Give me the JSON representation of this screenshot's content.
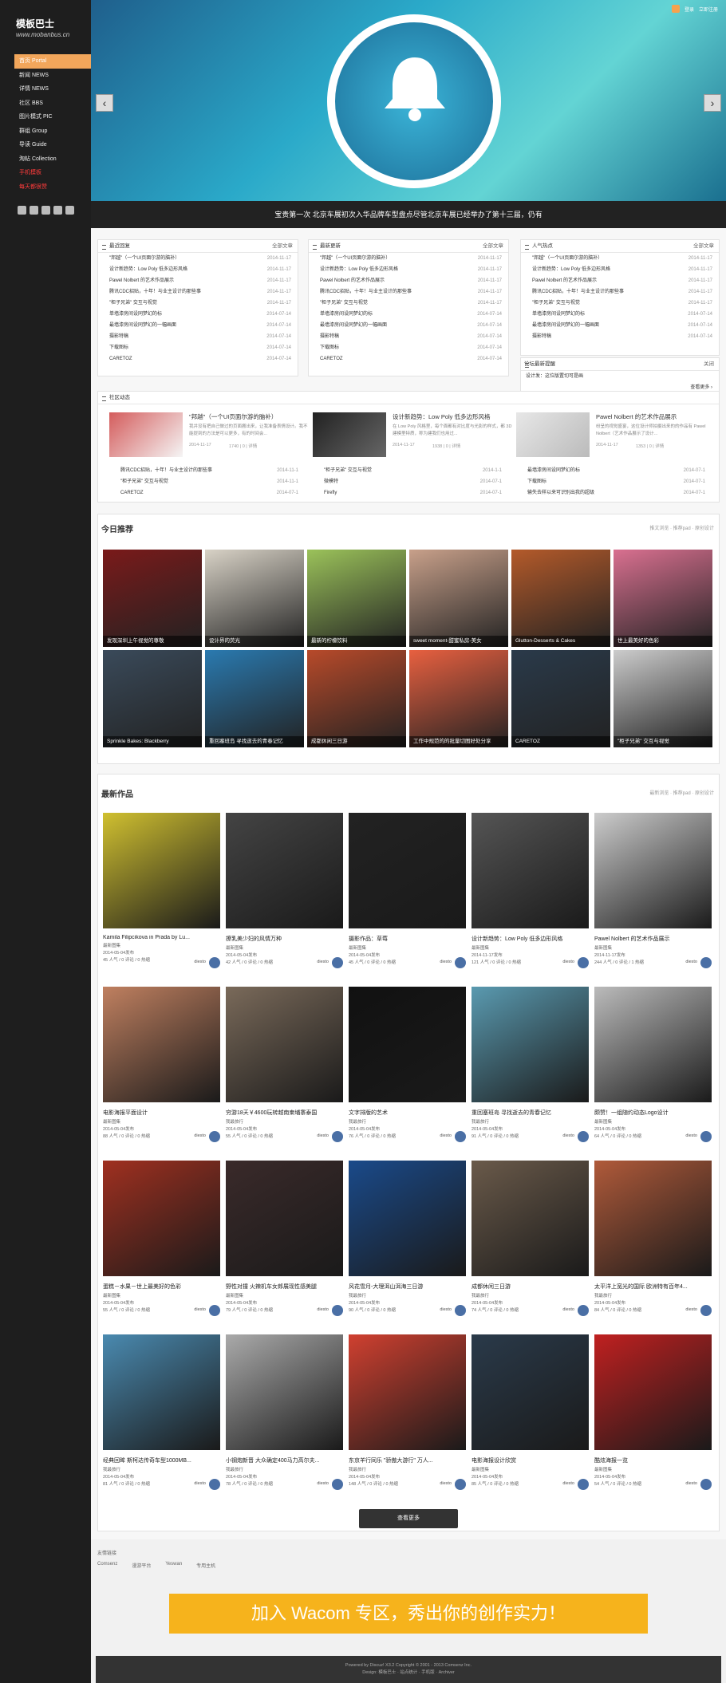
{
  "logo": {
    "title": "模板巴士",
    "sub": "www.mobanbus.cn"
  },
  "nav": [
    "首页 Portal",
    "新闻 NEWS",
    "详情 NEWS",
    "社区 BBS",
    "图片模式 PIC",
    "群组 Group",
    "导读 Guide",
    "淘帖 Collection",
    "手机模板",
    "每天都很赞"
  ],
  "topbar": {
    "login": "登录",
    "register": "立即注册"
  },
  "banner": {
    "caption": "宝贵第一次 北京车展初次入华品牌车型盘点尽管北京车展已经举办了第十三届，仍有"
  },
  "panels": [
    {
      "title": "最近回复",
      "more": "全部文章",
      "items": [
        [
          "\"邦越\"（一个UI页面尔游的脑补）",
          "2014-11-17"
        ],
        [
          "设计新趋势：Low Poly 低多边形风格",
          "2014-11-17"
        ],
        [
          "Pawel Nolbert 的艺术作品展示",
          "2014-11-17"
        ],
        [
          "腾讯CDC招贴，十年！与业主设计的那些事",
          "2014-11-17"
        ],
        [
          "\"柜子兄弟\" 交互与视觉",
          "2014-11-17"
        ],
        [
          "单墙漆房间设同梦幻的标",
          "2014-07-14"
        ],
        [
          "最墙漆房间设同梦幻的一幅画面",
          "2014-07-14"
        ],
        [
          "摄影特稿",
          "2014-07-14"
        ],
        [
          "下载图标",
          "2014-07-14"
        ],
        [
          "CARETOZ",
          "2014-07-14"
        ]
      ]
    },
    {
      "title": "最新更新",
      "more": "全部文章",
      "items": [
        [
          "\"邦越\"（一个UI页面尔游的脑补）",
          "2014-11-17"
        ],
        [
          "设计新趋势：Low Poly 低多边形风格",
          "2014-11-17"
        ],
        [
          "Pawel Nolbert 的艺术作品展示",
          "2014-11-17"
        ],
        [
          "腾讯CDC招贴，十年！与业主设计的那些事",
          "2014-11-17"
        ],
        [
          "\"柜子兄弟\" 交互与视觉",
          "2014-11-17"
        ],
        [
          "单墙漆房间设同梦幻的标",
          "2014-07-14"
        ],
        [
          "最墙漆房间设同梦幻的一幅画面",
          "2014-07-14"
        ],
        [
          "摄影特稿",
          "2014-07-14"
        ],
        [
          "下载图标",
          "2014-07-14"
        ],
        [
          "CARETOZ",
          "2014-07-14"
        ]
      ]
    },
    {
      "title": "人气热点",
      "more": "全部文章",
      "items": [
        [
          "\"邦越\"（一个UI页面尔游的脑补）",
          "2014-11-17"
        ],
        [
          "设计新趋势：Low Poly 低多边形风格",
          "2014-11-17"
        ],
        [
          "Pawel Nolbert 的艺术作品展示",
          "2014-11-17"
        ],
        [
          "腾讯CDC招贴，十年！与业主设计的那些事",
          "2014-11-17"
        ],
        [
          "\"柜子兄弟\" 交互与视觉",
          "2014-11-17"
        ],
        [
          "单墙漆房间设同梦幻的标",
          "2014-07-14"
        ],
        [
          "最墙漆房间设同梦幻的一幅画面",
          "2014-07-14"
        ],
        [
          "摄影特稿",
          "2014-07-14"
        ],
        [
          "下载图标",
          "2014-07-14"
        ],
        [
          "CARETOZ",
          "2014-07-14"
        ]
      ]
    }
  ],
  "notice": {
    "title": "论坛最新提醒",
    "close": "关闭",
    "text": "设计发：这位版置切可是画",
    "more": "查看更多 ›"
  },
  "community": {
    "title": "社区动态",
    "features": [
      {
        "title": "\"邦越\"（一个UI页面尔游的脑补）",
        "desc": "我并没有把自己做过的页面搬出来，让我准备表情设计。我不能提到的方法是可以更多，有的时间会...",
        "date": "2014-11-17",
        "stat": "1740 | 0 | 详情"
      },
      {
        "title": "设计新趋势：Low Poly 低多边形风格",
        "desc": "在 Low Poly 风格里，每个面都有对比度与光影的样式，都 3D 建模里特质，称为建我们也用过...",
        "date": "2014-11-17",
        "stat": "1938 | 0 | 详情"
      },
      {
        "title": "Pawel Nolbert 的艺术作品展示",
        "desc": "纷呈的视觉盛宴，这位设计师拍摄出来的的作品有 Pawel Nolbert（艺术作品展示了设计...",
        "date": "2014-11-17",
        "stat": "1353 | 0 | 详情"
      }
    ],
    "list": [
      [
        [
          "腾讯CDC招贴，十年！与业主设计的那些事",
          "2014-11-1"
        ],
        [
          "\"柜子兄弟\" 交互与视觉",
          "2014-11-1"
        ]
      ],
      [
        [
          "\"柜子兄弟\" 交互与视觉",
          "2014-1-1"
        ],
        [
          "微模特",
          "2014-07-1"
        ]
      ],
      [
        [
          "最墙漆房间设同梦幻的标",
          "2014-07-1"
        ],
        [
          "下载图标",
          "2014-07-1"
        ]
      ]
    ],
    "list2": [
      [
        "CARETOZ",
        "2014-07-1"
      ],
      [
        "Firefly",
        "2014-07-1"
      ],
      [
        "输失去样以来可识别出我的超级",
        "2014-07-1"
      ]
    ]
  },
  "today": {
    "title": "今日推荐",
    "more": "推文浏览 · 推荐pad · 原创设计",
    "items": [
      "发现深圳上午视觉的尊敬",
      "设计界的荧光",
      "最新的柠檬饮料",
      "sweet moment-甜蜜私房-美女",
      "Glutton-Desserts & Cakes",
      "世上最美好的色彩",
      "Sprinkle Bakes: Blackberry",
      "重回塞班岛 寻找逝去的青春记忆",
      "成都休闲三日游",
      "工作中规范的的批量切图好处分享",
      "CARETOZ",
      "\"柜子兄弟\" 交互与视觉"
    ]
  },
  "latest": {
    "title": "最新作品",
    "more": "最新浏览 · 推荐pad · 原创设计",
    "items": [
      {
        "t": "Kamila Filipcikova in Prada by Lu...",
        "c": "最新图集",
        "d": "2014-05-04发布",
        "s": "45 人气 / 0 评论 / 0 热缩",
        "u": "diesto"
      },
      {
        "t": "撩乳美少妇的风情万种",
        "c": "最新图集",
        "d": "2014-05-04发布",
        "s": "42 人气 / 0 评论 / 0 热缩",
        "u": "diesto"
      },
      {
        "t": "摄影作品：草莓",
        "c": "最新图集",
        "d": "2014-05-04发布",
        "s": "45 人气 / 0 评论 / 0 热缩",
        "u": "diesto"
      },
      {
        "t": "设计新趋势：Low Poly 低多边形风格",
        "c": "最新图集",
        "d": "2014-11-17发布",
        "s": "121 人气 / 0 评论 / 0 热缩",
        "u": "diesto"
      },
      {
        "t": "Pawel Nolbert 的艺术作品展示",
        "c": "最新图集",
        "d": "2014-11-17发布",
        "s": "244 人气 / 0 评论 / 1 热缩",
        "u": "diesto"
      },
      {
        "t": "电影海报平面设计",
        "c": "最新图集",
        "d": "2014-05-04发布",
        "s": "88 人气 / 0 评论 / 0 热缩",
        "u": "diesto"
      },
      {
        "t": "穷游18天￥4600玩转越南柬埔寨泰国",
        "c": "我最旅行",
        "d": "2014-05-04发布",
        "s": "55 人气 / 0 评论 / 0 热缩",
        "u": "diesto"
      },
      {
        "t": "文字排版的艺术",
        "c": "我最旅行",
        "d": "2014-05-04发布",
        "s": "76 人气 / 0 评论 / 0 热缩",
        "u": "diesto"
      },
      {
        "t": "重回塞班岛 寻找逝去的青春记忆",
        "c": "我最旅行",
        "d": "2014-05-04发布",
        "s": "91 人气 / 0 评论 / 0 热缩",
        "u": "diesto"
      },
      {
        "t": "颇赞！一组随约动态Logo设计",
        "c": "最新图集",
        "d": "2014-05-04发布",
        "s": "64 人气 / 0 评论 / 0 热缩",
        "u": "diesto"
      },
      {
        "t": "蛋糕－水果－世上最美好的色彩",
        "c": "最新图集",
        "d": "2014-05-04发布",
        "s": "55 人气 / 0 评论 / 0 热缩",
        "u": "diesto"
      },
      {
        "t": "野性对撞 火辣机车女郎展现性感美腿",
        "c": "最新图集",
        "d": "2014-05-04发布",
        "s": "79 人气 / 0 评论 / 0 热缩",
        "u": "diesto"
      },
      {
        "t": "风花雪月-大理洱山洱海三日游",
        "c": "我最旅行",
        "d": "2014-05-04发布",
        "s": "90 人气 / 0 评论 / 0 热缩",
        "u": "diesto"
      },
      {
        "t": "成都休闲三日游",
        "c": "我最旅行",
        "d": "2014-05-04发布",
        "s": "74 人气 / 0 评论 / 0 热缩",
        "u": "diesto"
      },
      {
        "t": "太平洋上宽光的国际 欧洲特有百年4...",
        "c": "我最旅行",
        "d": "2014-05-04发布",
        "s": "84 人气 / 0 评论 / 0 热缩",
        "u": "diesto"
      },
      {
        "t": "经典回眸 斯柯达传奇车型1000MB...",
        "c": "我最旅行",
        "d": "2014-05-04发布",
        "s": "81 人气 / 0 评论 / 0 热缩",
        "u": "diesto"
      },
      {
        "t": "小钢炮新晋 大众确定400马力高尔夫...",
        "c": "我最旅行",
        "d": "2014-05-04发布",
        "s": "78 人气 / 0 评论 / 0 热缩",
        "u": "diesto"
      },
      {
        "t": "东京羊行同乐 \"骄傲大游行\" 万人...",
        "c": "我最旅行",
        "d": "2014-05-04发布",
        "s": "148 人气 / 0 评论 / 0 热缩",
        "u": "diesto"
      },
      {
        "t": "电影海报设计欣赏",
        "c": "最新图集",
        "d": "2014-05-04发布",
        "s": "85 人气 / 0 评论 / 0 热缩",
        "u": "diesto"
      },
      {
        "t": "酷炫海报一览",
        "c": "最新图集",
        "d": "2014-05-04发布",
        "s": "54 人气 / 0 评论 / 0 热缩",
        "u": "diesto"
      }
    ]
  },
  "loadmore": "查看更多",
  "footer": {
    "links_title": "友情链接",
    "links": [
      "Comsenz",
      "漫游平台",
      "Yeswan",
      "专用主机"
    ],
    "banner": "加入 Wacom 专区，秀出你的创作实力！",
    "copy1": "Powered by Discuz! X3.2 Copyright © 2001 - 2013 Comsenz Inc.",
    "copy2": "Design: 模板巴士 · 站点统计 · 手机版 · Archiver"
  },
  "colors": {
    "accent": "#f2a65b",
    "sidebar": "#1e1e1e",
    "red": "#ff3b3b"
  }
}
